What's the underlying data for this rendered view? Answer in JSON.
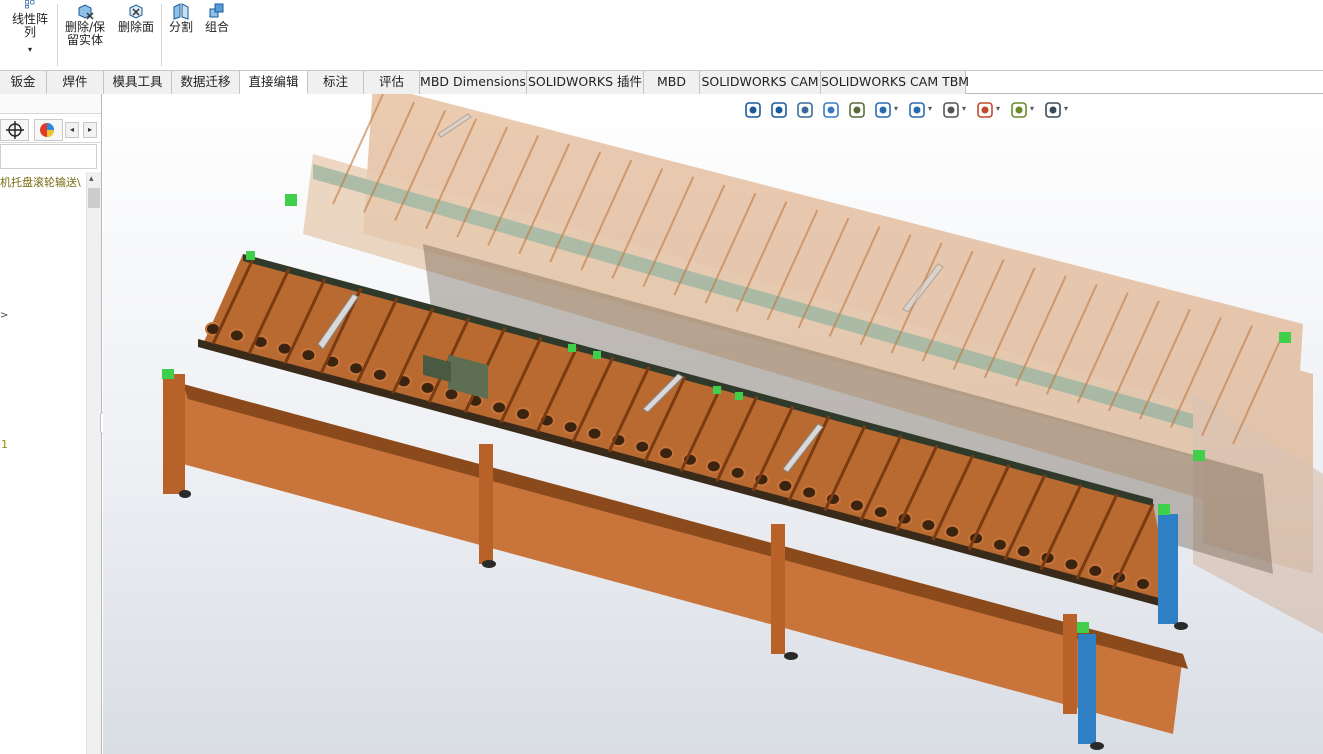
{
  "ribbon": {
    "buttons": [
      {
        "label": "线性阵\n列",
        "icon": "linear-pattern-icon"
      },
      {
        "label": "删除/保\n留实体",
        "icon": "delete-keep-body-icon"
      },
      {
        "label": "删除面",
        "icon": "delete-face-icon"
      },
      {
        "label": "分割",
        "icon": "split-icon"
      },
      {
        "label": "组合",
        "icon": "combine-icon"
      }
    ],
    "more_arrow": "▾"
  },
  "tabs": [
    {
      "label": "钣金"
    },
    {
      "label": "焊件"
    },
    {
      "label": "模具工具"
    },
    {
      "label": "数据迁移"
    },
    {
      "label": "直接编辑",
      "active": true
    },
    {
      "label": "标注"
    },
    {
      "label": "评估"
    },
    {
      "label": "MBD Dimensions"
    },
    {
      "label": "SOLIDWORKS 插件"
    },
    {
      "label": "MBD"
    },
    {
      "label": "SOLIDWORKS CAM"
    },
    {
      "label": "SOLIDWORKS CAM TBM"
    }
  ],
  "left_panel": {
    "tree_label": "机托盘滚轮输送\\",
    "marker_1": ">",
    "marker_2": "1",
    "nav_left": "◂",
    "nav_right": "▸",
    "scroll_up": "▴",
    "collapse_handle": "‹"
  },
  "viewport": {
    "heads_up_icons": [
      "zoom-to-fit-icon",
      "zoom-to-area-icon",
      "previous-view-icon",
      "section-view-icon",
      "dynamic-annotation-icon",
      "view-orientation-icon",
      "display-style-icon",
      "hide-show-items-icon",
      "edit-appearance-icon",
      "apply-scene-icon",
      "view-settings-icon"
    ],
    "dropdown_arrow": "▾",
    "colors": {
      "frame_orange": "#c8743a",
      "frame_dark": "#8a4a1c",
      "rail_green": "#6f8a62",
      "bracket_green": "#3fcf4a",
      "post_blue": "#2e7fc4",
      "ghost_orange": "#d9a070"
    }
  }
}
